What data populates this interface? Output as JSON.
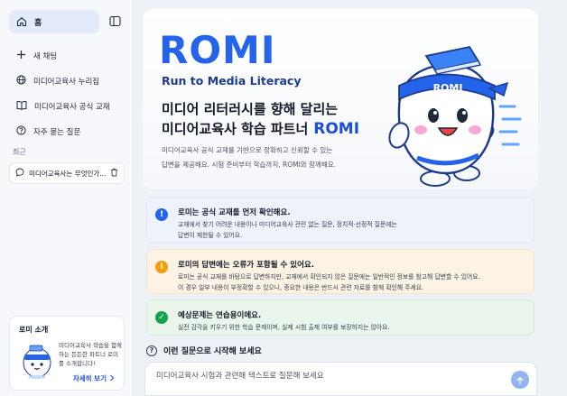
{
  "sidebar": {
    "home_label": "홈",
    "nav": [
      {
        "label": "새 채팅",
        "icon": "plus-icon"
      },
      {
        "label": "미디어교육사 누리집",
        "icon": "globe-icon"
      },
      {
        "label": "미디어교육사 공식 교재",
        "icon": "book-icon"
      },
      {
        "label": "자주 묻는 질문",
        "icon": "help-circle-icon"
      }
    ],
    "recent_label": "최근",
    "recent_items": [
      {
        "label": "미디어교육사는 무엇인가..."
      }
    ],
    "about": {
      "title": "로미 소개",
      "description": "미디어교육사 학습을 함께하는 든든한 파트너 로미를 소개합니다!",
      "more": "자세히 보기"
    }
  },
  "hero": {
    "logo_text": "ROMI",
    "tagline": "Run to Media Literacy",
    "headline_line1": "미디어 리터러시를 향해 달리는",
    "headline_line2": "미디어교육사 학습 파트너",
    "headline_brand": "ROMI",
    "description_line1": "미디어교육사 공식 교재를 기반으로 정확하고 신뢰할 수 있는",
    "description_line2": "답변을 제공해요. 시험 준비부터 학습까지, ROMI와 함께해요.",
    "mascot_headband_text": "ROMI"
  },
  "notices": [
    {
      "title": "로미는 공식 교재를 먼저 확인해요.",
      "line1": "교재에서 찾기 어려운 내용이나 미디어교육사 관련 없는 질문, 정치적·선정적 질문에는",
      "line2": "답변이 제한될 수 있어요.",
      "icon": "info-icon",
      "color": "#2563eb"
    },
    {
      "title": "로미의 답변에는 오류가 포함될 수 있어요.",
      "line1": "로미는 공식 교재를 바탕으로 답변하지만, 교재에서 확인되지 않은 질문에는 일반적인 정보를 참고해 답변할 수 있어요.",
      "line2": "이 경우 일부 내용이 부정확할 수 있으니, 중요한 내용은 반드시 관련 자료를 함께 확인해 주세요.",
      "icon": "warning-icon",
      "color": "#f59e0b"
    },
    {
      "title": "예상문제는 연습용이에요.",
      "line1": "실전 감각을 키우기 위한 학습 문제이며, 실제 시험 출제 여부를 보장하지는 않아요.",
      "line2": "",
      "icon": "check-icon",
      "color": "#16a34a"
    }
  ],
  "chat": {
    "start_label": "이런 질문으로 시작해 보세요",
    "placeholder": "미디어교육사 시험과 관련해 텍스트로 질문해 보세요"
  },
  "colors": {
    "brand": "#2563eb",
    "sidebar_active": "#e3ebfb",
    "send_button": "#93b4f3"
  }
}
